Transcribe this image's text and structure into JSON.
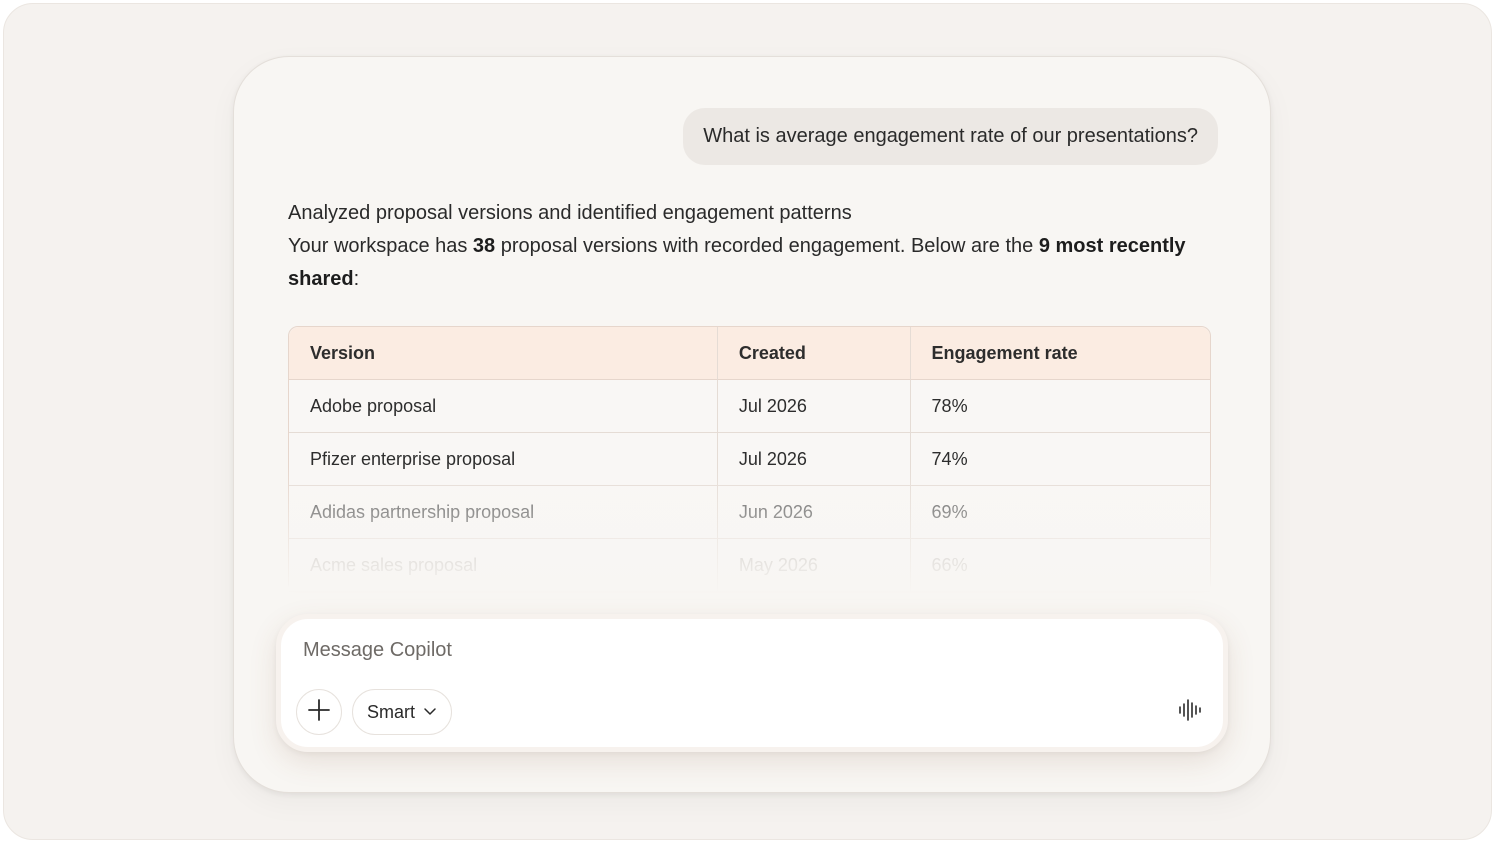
{
  "conversation": {
    "user_message": "What is average engagement rate of our presentations?",
    "answer": {
      "line1": "Analyzed proposal versions and identified engagement patterns",
      "line2_prefix": "Your workspace has ",
      "line2_count": "38",
      "line2_middle": " proposal versions with recorded engagement. Below are the ",
      "line2_bold": "9 most recently shared",
      "line2_suffix": ":"
    }
  },
  "table": {
    "headers": [
      "Version",
      "Created",
      "Engagement rate"
    ],
    "rows": [
      [
        "Adobe proposal",
        "Jul 2026",
        "78%"
      ],
      [
        "Pfizer enterprise proposal",
        "Jul 2026",
        "74%"
      ],
      [
        "Adidas partnership proposal",
        "Jun 2026",
        "69%"
      ],
      [
        "Acme sales proposal",
        "May 2026",
        "66%"
      ]
    ]
  },
  "composer": {
    "placeholder": "Message Copilot",
    "mode_label": "Smart",
    "add_icon": "plus-icon",
    "mode_icon": "chevron-down-icon",
    "voice_icon": "voice-waveform-icon"
  },
  "colors": {
    "page_bg": "#f5f2ef",
    "panel_bg": "#f8f6f3",
    "table_header_bg": "#fbece2",
    "user_bubble_bg": "#ece8e4"
  }
}
